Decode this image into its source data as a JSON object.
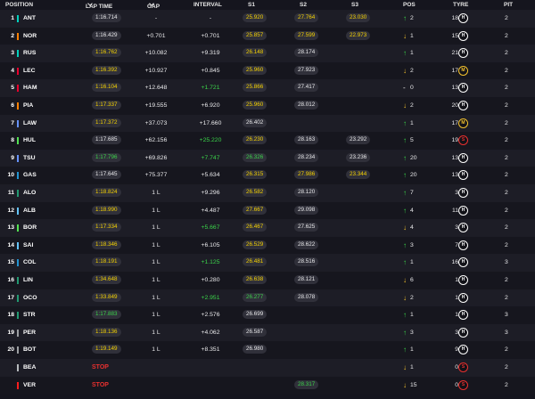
{
  "header": {
    "position": "POSITION",
    "lap_time": "LAP TIME",
    "gap": "GAP",
    "interval": "INTERVAL",
    "s1": "S1",
    "s2": "S2",
    "s3": "S3",
    "pos": "POS",
    "tyre": "TYRE",
    "pit": "PIT"
  },
  "colors": {
    "yellow": "#f5d200",
    "green": "#3bd34a",
    "white": "#e8e8ea",
    "red": "#e8302f",
    "soft": "#e8302f",
    "medium": "#f2c12e",
    "hard": "#ffffff"
  },
  "rows": [
    {
      "pos": "1",
      "team": "#00d2be",
      "code": "ANT",
      "lap": "1:16.714",
      "lapc": "wht",
      "gap": "-",
      "int": "-",
      "intc": "wht",
      "s1": "25.920",
      "s1c": "yel",
      "s2": "27.764",
      "s2c": "yel",
      "s3": "23.030",
      "s3c": "yel",
      "arrow": "↑",
      "dir": "up",
      "ch": "2",
      "tl": "18",
      "tyre": "H",
      "tc": "H",
      "pit": "2"
    },
    {
      "pos": "2",
      "team": "#ff8000",
      "code": "NOR",
      "lap": "1:16.429",
      "lapc": "wht",
      "gap": "+0.701",
      "int": "+0.701",
      "intc": "wht",
      "s1": "25.857",
      "s1c": "yel",
      "s2": "27.599",
      "s2c": "yel",
      "s3": "22.973",
      "s3c": "yel",
      "arrow": "↓",
      "dir": "down",
      "ch": "1",
      "tl": "15",
      "tyre": "H",
      "tc": "H",
      "pit": "2"
    },
    {
      "pos": "3",
      "team": "#00d2be",
      "code": "RUS",
      "lap": "1:16.762",
      "lapc": "yel",
      "gap": "+10.082",
      "int": "+9.319",
      "intc": "wht",
      "s1": "26.148",
      "s1c": "yel",
      "s2": "28.174",
      "s2c": "wht",
      "s3": "",
      "s3c": "wht",
      "arrow": "↑",
      "dir": "up",
      "ch": "1",
      "tl": "21",
      "tyre": "H",
      "tc": "H",
      "pit": "2"
    },
    {
      "pos": "4",
      "team": "#e8002d",
      "code": "LEC",
      "lap": "1:16.392",
      "lapc": "yel",
      "gap": "+10.927",
      "int": "+0.845",
      "intc": "wht",
      "s1": "25.960",
      "s1c": "yel",
      "s2": "27.923",
      "s2c": "wht",
      "s3": "",
      "s3c": "wht",
      "arrow": "↓",
      "dir": "down",
      "ch": "2",
      "tl": "17",
      "tyre": "M",
      "tc": "M",
      "pit": "2"
    },
    {
      "pos": "5",
      "team": "#e8002d",
      "code": "HAM",
      "lap": "1:16.104",
      "lapc": "yel",
      "gap": "+12.648",
      "int": "+1.721",
      "intc": "grn",
      "s1": "25.866",
      "s1c": "yel",
      "s2": "27.417",
      "s2c": "wht",
      "s3": "",
      "s3c": "wht",
      "arrow": "-",
      "dir": "none",
      "ch": "0",
      "tl": "13",
      "tyre": "H",
      "tc": "H",
      "pit": "2"
    },
    {
      "pos": "6",
      "team": "#ff8000",
      "code": "PIA",
      "lap": "1:17.337",
      "lapc": "yel",
      "gap": "+19.555",
      "int": "+6.920",
      "intc": "wht",
      "s1": "25.960",
      "s1c": "yel",
      "s2": "28.012",
      "s2c": "wht",
      "s3": "",
      "s3c": "wht",
      "arrow": "↓",
      "dir": "down",
      "ch": "2",
      "tl": "20",
      "tyre": "H",
      "tc": "H",
      "pit": "2"
    },
    {
      "pos": "7",
      "team": "#6692ff",
      "code": "LAW",
      "lap": "1:17.372",
      "lapc": "yel",
      "gap": "+37.073",
      "int": "+17.660",
      "intc": "wht",
      "s1": "26.402",
      "s1c": "wht",
      "s2": "",
      "s2c": "wht",
      "s3": "",
      "s3c": "wht",
      "arrow": "↑",
      "dir": "up",
      "ch": "1",
      "tl": "17",
      "tyre": "M",
      "tc": "M",
      "pit": "2"
    },
    {
      "pos": "8",
      "team": "#52e252",
      "code": "HUL",
      "lap": "1:17.685",
      "lapc": "wht",
      "gap": "+62.156",
      "int": "+25.220",
      "intc": "grn",
      "s1": "26.230",
      "s1c": "yel",
      "s2": "28.163",
      "s2c": "wht",
      "s3": "23.292",
      "s3c": "wht",
      "arrow": "↑",
      "dir": "up",
      "ch": "5",
      "tl": "19",
      "tyre": "S",
      "tc": "S",
      "pit": "2"
    },
    {
      "pos": "9",
      "team": "#6692ff",
      "code": "TSU",
      "lap": "1:17.796",
      "lapc": "grn",
      "gap": "+69.826",
      "int": "+7.747",
      "intc": "grn",
      "s1": "26.326",
      "s1c": "grn",
      "s2": "28.234",
      "s2c": "wht",
      "s3": "23.236",
      "s3c": "wht",
      "arrow": "↑",
      "dir": "up",
      "ch": "20",
      "tl": "13",
      "tyre": "H",
      "tc": "H",
      "pit": "2"
    },
    {
      "pos": "10",
      "team": "#2293d1",
      "code": "GAS",
      "lap": "1:17.645",
      "lapc": "wht",
      "gap": "+75.377",
      "int": "+5.634",
      "intc": "wht",
      "s1": "26.315",
      "s1c": "yel",
      "s2": "27.986",
      "s2c": "yel",
      "s3": "23.344",
      "s3c": "yel",
      "arrow": "↑",
      "dir": "up",
      "ch": "20",
      "tl": "13",
      "tyre": "H",
      "tc": "H",
      "pit": "2"
    },
    {
      "pos": "11",
      "team": "#229971",
      "code": "ALO",
      "lap": "1:18.824",
      "lapc": "yel",
      "gap": "1 L",
      "int": "+9.296",
      "intc": "wht",
      "s1": "26.582",
      "s1c": "yel",
      "s2": "28.120",
      "s2c": "wht",
      "s3": "",
      "s3c": "wht",
      "arrow": "↑",
      "dir": "up",
      "ch": "7",
      "tl": "3",
      "tyre": "H",
      "tc": "H",
      "pit": "2"
    },
    {
      "pos": "12",
      "team": "#64c4ff",
      "code": "ALB",
      "lap": "1:18.990",
      "lapc": "yel",
      "gap": "1 L",
      "int": "+4.487",
      "intc": "wht",
      "s1": "27.667",
      "s1c": "yel",
      "s2": "29.098",
      "s2c": "wht",
      "s3": "",
      "s3c": "wht",
      "arrow": "↑",
      "dir": "up",
      "ch": "4",
      "tl": "11",
      "tyre": "H",
      "tc": "H",
      "pit": "2"
    },
    {
      "pos": "13",
      "team": "#52e252",
      "code": "BOR",
      "lap": "1:17.334",
      "lapc": "yel",
      "gap": "1 L",
      "int": "+5.667",
      "intc": "grn",
      "s1": "26.467",
      "s1c": "yel",
      "s2": "27.625",
      "s2c": "wht",
      "s3": "",
      "s3c": "wht",
      "arrow": "↓",
      "dir": "down",
      "ch": "4",
      "tl": "3",
      "tyre": "H",
      "tc": "H",
      "pit": "2"
    },
    {
      "pos": "14",
      "team": "#64c4ff",
      "code": "SAI",
      "lap": "1:18.346",
      "lapc": "yel",
      "gap": "1 L",
      "int": "+6.105",
      "intc": "wht",
      "s1": "26.529",
      "s1c": "yel",
      "s2": "28.622",
      "s2c": "wht",
      "s3": "",
      "s3c": "wht",
      "arrow": "↑",
      "dir": "up",
      "ch": "3",
      "tl": "7",
      "tyre": "H",
      "tc": "H",
      "pit": "2"
    },
    {
      "pos": "15",
      "team": "#2293d1",
      "code": "COL",
      "lap": "1:18.191",
      "lapc": "yel",
      "gap": "1 L",
      "int": "+1.125",
      "intc": "grn",
      "s1": "26.481",
      "s1c": "yel",
      "s2": "28.516",
      "s2c": "wht",
      "s3": "",
      "s3c": "wht",
      "arrow": "↑",
      "dir": "up",
      "ch": "1",
      "tl": "16",
      "tyre": "H",
      "tc": "H",
      "pit": "3"
    },
    {
      "pos": "16",
      "team": "#229971",
      "code": "LIN",
      "lap": "1:34.648",
      "lapc": "yel",
      "gap": "1 L",
      "int": "+0.280",
      "intc": "wht",
      "s1": "26.638",
      "s1c": "yel",
      "s2": "28.121",
      "s2c": "wht",
      "s3": "",
      "s3c": "wht",
      "arrow": "↓",
      "dir": "down",
      "ch": "6",
      "tl": "1",
      "tyre": "H",
      "tc": "H",
      "pit": "2"
    },
    {
      "pos": "17",
      "team": "#229971",
      "code": "OCO",
      "lap": "1:33.849",
      "lapc": "yel",
      "gap": "1 L",
      "int": "+2.951",
      "intc": "grn",
      "s1": "26.277",
      "s1c": "grn",
      "s2": "28.078",
      "s2c": "wht",
      "s3": "",
      "s3c": "wht",
      "arrow": "↓",
      "dir": "down",
      "ch": "2",
      "tl": "1",
      "tyre": "H",
      "tc": "H",
      "pit": "2"
    },
    {
      "pos": "18",
      "team": "#229971",
      "code": "STR",
      "lap": "1:17.883",
      "lapc": "grn",
      "gap": "1 L",
      "int": "+2.576",
      "intc": "wht",
      "s1": "26.699",
      "s1c": "wht",
      "s2": "",
      "s2c": "wht",
      "s3": "",
      "s3c": "wht",
      "arrow": "↑",
      "dir": "up",
      "ch": "1",
      "tl": "1",
      "tyre": "H",
      "tc": "H",
      "pit": "3"
    },
    {
      "pos": "19",
      "team": "#9c9fa2",
      "code": "PER",
      "lap": "1:18.136",
      "lapc": "yel",
      "gap": "1 L",
      "int": "+4.062",
      "intc": "wht",
      "s1": "26.587",
      "s1c": "wht",
      "s2": "",
      "s2c": "wht",
      "s3": "",
      "s3c": "wht",
      "arrow": "↑",
      "dir": "up",
      "ch": "3",
      "tl": "3",
      "tyre": "H",
      "tc": "H",
      "pit": "3"
    },
    {
      "pos": "20",
      "team": "#9c9fa2",
      "code": "BOT",
      "lap": "1:19.149",
      "lapc": "yel",
      "gap": "1 L",
      "int": "+8.351",
      "intc": "wht",
      "s1": "26.980",
      "s1c": "wht",
      "s2": "",
      "s2c": "wht",
      "s3": "",
      "s3c": "wht",
      "arrow": "↑",
      "dir": "up",
      "ch": "1",
      "tl": "9",
      "tyre": "H",
      "tc": "H",
      "pit": "2"
    },
    {
      "pos": "",
      "team": "#b6babd",
      "code": "BEA",
      "lap": "STOP",
      "lapc": "stop",
      "gap": "",
      "int": "",
      "intc": "wht",
      "s1": "",
      "s1c": "wht",
      "s2": "",
      "s2c": "wht",
      "s3": "",
      "s3c": "wht",
      "arrow": "↓",
      "dir": "down",
      "ch": "1",
      "tl": "0",
      "tyre": "S",
      "tc": "S",
      "pit": "2"
    },
    {
      "pos": "",
      "team": "#ff1e1e",
      "code": "VER",
      "lap": "STOP",
      "lapc": "stop",
      "gap": "",
      "int": "",
      "intc": "wht",
      "s1": "",
      "s1c": "wht",
      "s2": "28.317",
      "s2c": "grn",
      "s3": "",
      "s3c": "wht",
      "arrow": "↓",
      "dir": "down",
      "ch": "15",
      "tl": "0",
      "tyre": "S",
      "tc": "S",
      "pit": "2"
    }
  ]
}
